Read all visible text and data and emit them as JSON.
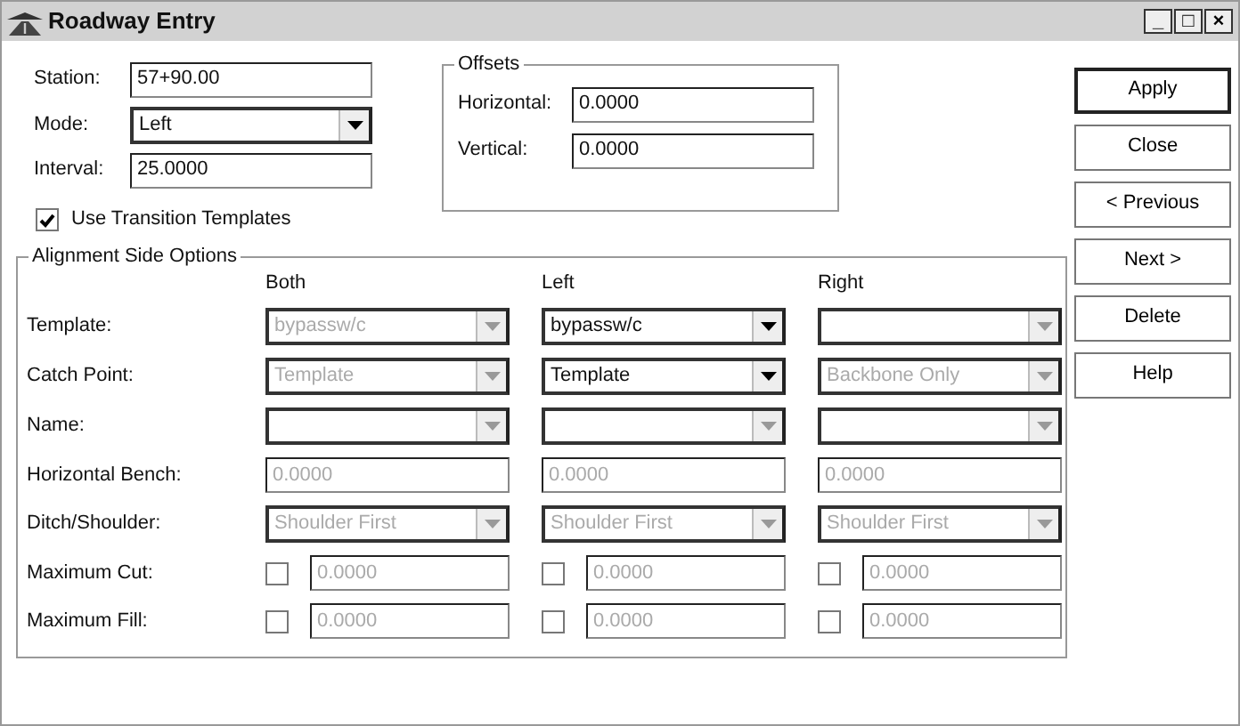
{
  "window": {
    "title": "Roadway Entry",
    "controls": [
      "_",
      "□",
      "×"
    ]
  },
  "station": {
    "label": "Station:",
    "value": "57+90.00"
  },
  "mode": {
    "label": "Mode:",
    "value": "Left"
  },
  "interval": {
    "label": "Interval:",
    "value": "25.0000"
  },
  "use_transition_templates": {
    "label": "Use Transition Templates",
    "checked": true
  },
  "offsets": {
    "title": "Offsets",
    "fields": [
      {
        "label": "Horizontal:",
        "value": "0.0000"
      },
      {
        "label": "Vertical:",
        "value": "0.0000"
      }
    ]
  },
  "alignment_side_options": {
    "title": "Alignment Side Options",
    "columns": [
      "Both",
      "Left",
      "Right"
    ],
    "rows": [
      {
        "label": "Template:",
        "kind": "select",
        "cells": [
          {
            "value": "bypassw/c",
            "disabled": true
          },
          {
            "value": "bypassw/c",
            "disabled": false
          },
          {
            "disabled": true
          }
        ]
      },
      {
        "label": "Catch Point:",
        "kind": "select",
        "cells": [
          {
            "value": "Template",
            "disabled": true
          },
          {
            "value": "Template",
            "disabled": false
          },
          {
            "value": "Backbone Only",
            "disabled": true
          }
        ]
      },
      {
        "label": "Name:",
        "kind": "select",
        "cells": [
          {
            "disabled": true
          },
          {
            "disabled": true
          },
          {
            "disabled": true
          }
        ]
      },
      {
        "label": "Horizontal Bench:",
        "kind": "text",
        "cells": [
          {
            "value": "0.0000",
            "disabled": true
          },
          {
            "value": "0.0000",
            "disabled": true
          },
          {
            "value": "0.0000",
            "disabled": true
          }
        ]
      },
      {
        "label": "Ditch/Shoulder:",
        "kind": "select",
        "cells": [
          {
            "value": "Shoulder First",
            "disabled": true
          },
          {
            "value": "Shoulder First",
            "disabled": true
          },
          {
            "value": "Shoulder First",
            "disabled": true
          }
        ]
      },
      {
        "label": "Maximum Cut:",
        "kind": "check_text",
        "cells": [
          {
            "checked": false,
            "value": "0.0000",
            "disabled": true
          },
          {
            "checked": false,
            "value": "0.0000",
            "disabled": true
          },
          {
            "checked": false,
            "value": "0.0000",
            "disabled": true
          }
        ]
      },
      {
        "label": "Maximum Fill:",
        "kind": "check_text",
        "cells": [
          {
            "checked": false,
            "value": "0.0000",
            "disabled": true
          },
          {
            "checked": false,
            "value": "0.0000",
            "disabled": true
          },
          {
            "checked": false,
            "value": "0.0000",
            "disabled": true
          }
        ]
      }
    ]
  },
  "buttons": [
    {
      "label": "Apply",
      "default": true
    },
    {
      "label": "Close",
      "default": false
    },
    {
      "label": "< Previous",
      "default": false
    },
    {
      "label": "Next >",
      "default": false
    },
    {
      "label": "Delete",
      "default": false
    },
    {
      "label": "Help",
      "default": false
    }
  ]
}
